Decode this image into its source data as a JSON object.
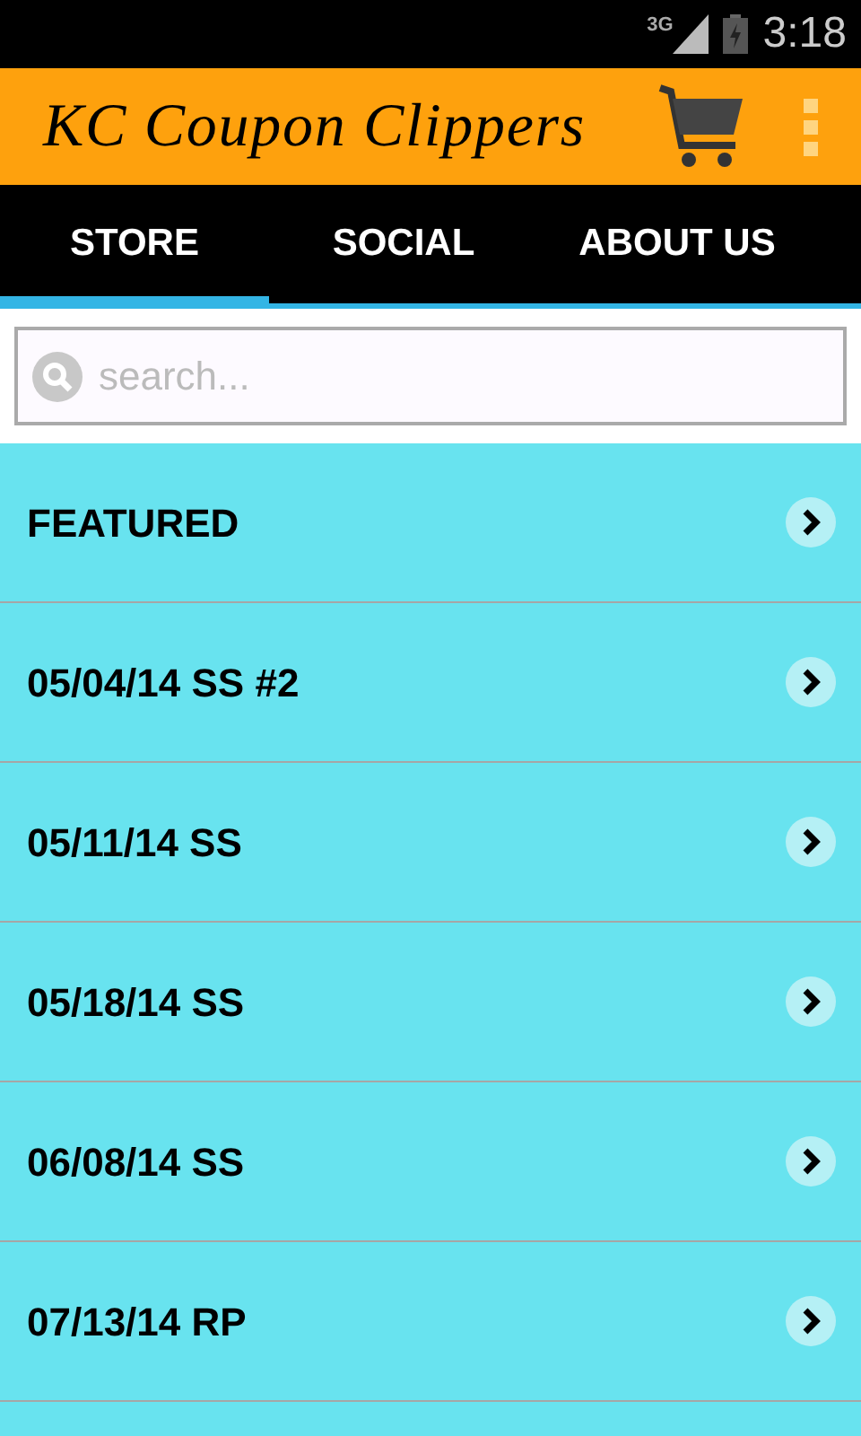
{
  "status_bar": {
    "network": "3G",
    "time": "3:18"
  },
  "app_bar": {
    "title": "KC Coupon Clippers"
  },
  "tabs": [
    {
      "label": "STORE",
      "selected": true
    },
    {
      "label": "SOCIAL",
      "selected": false
    },
    {
      "label": "ABOUT US",
      "selected": false
    }
  ],
  "search": {
    "placeholder": "search..."
  },
  "items": [
    {
      "label": "FEATURED"
    },
    {
      "label": "05/04/14 SS #2"
    },
    {
      "label": "05/11/14 SS"
    },
    {
      "label": "05/18/14 SS"
    },
    {
      "label": "06/08/14 SS"
    },
    {
      "label": "07/13/14 RP"
    }
  ]
}
